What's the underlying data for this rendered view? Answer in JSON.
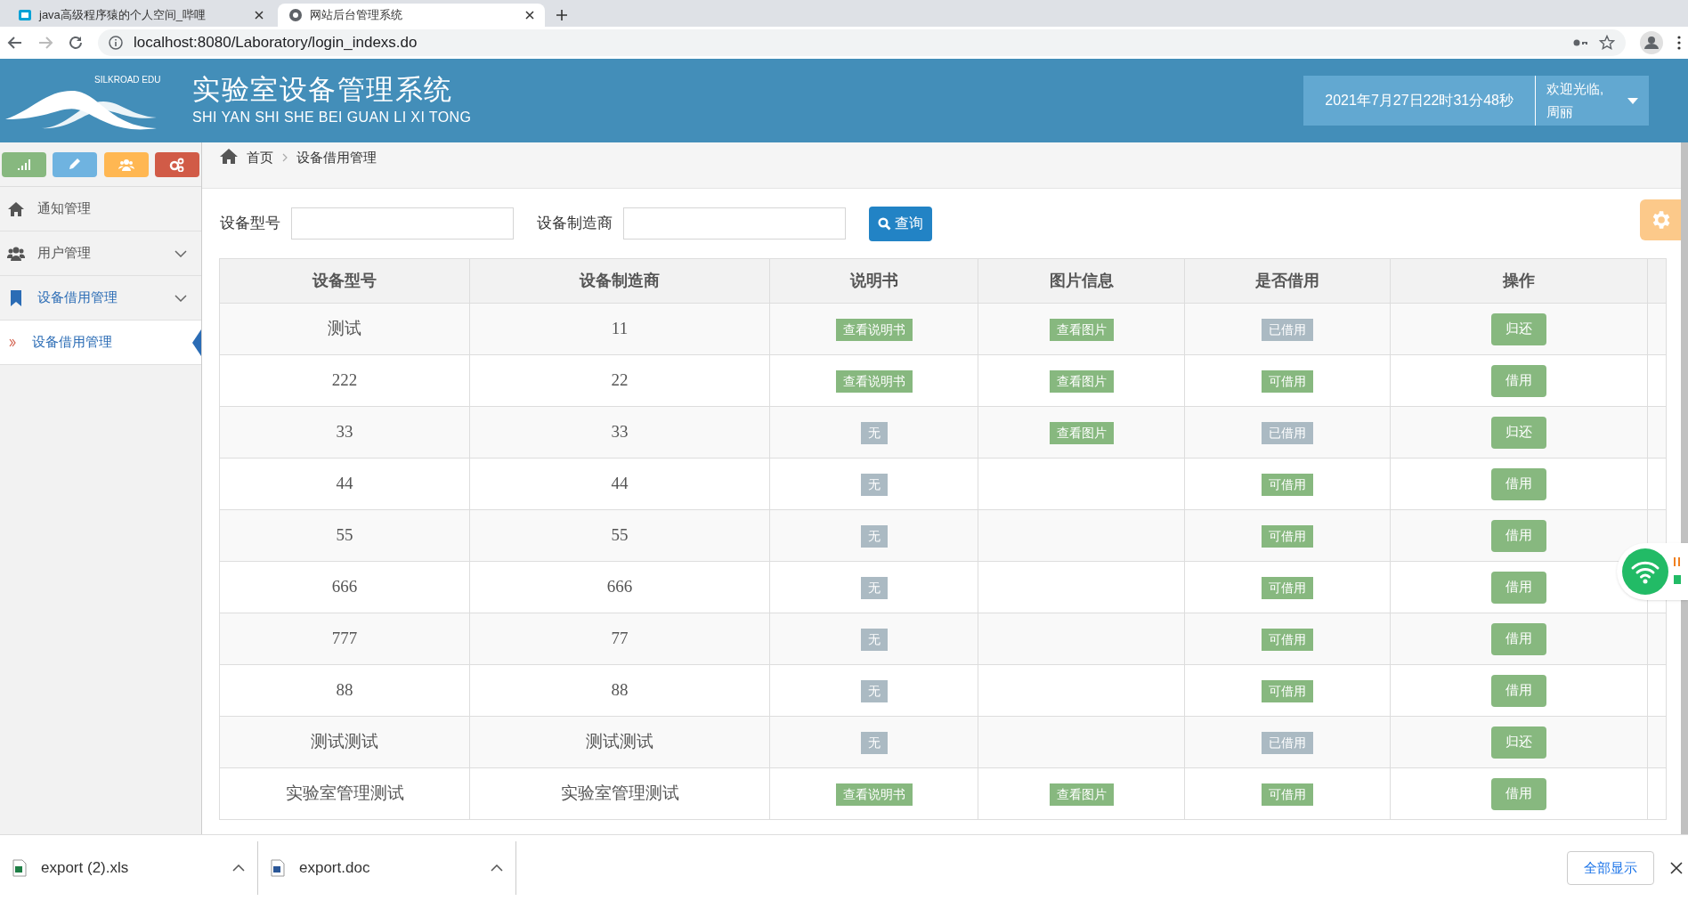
{
  "browser": {
    "tabs": [
      {
        "title": "java高级程序猿的个人空间_哔哩",
        "selected": false
      },
      {
        "title": "网站后台管理系统",
        "selected": true
      }
    ],
    "url": "localhost:8080/Laboratory/login_indexs.do"
  },
  "header": {
    "brand": "SILKROAD EDU",
    "title": "实验室设备管理系统",
    "subtitle": "SHI YAN SHI SHE BEI GUAN LI XI TONG",
    "datetime": "2021年7月27日22时31分48秒",
    "welcome": "欢迎光临,",
    "user": "周丽"
  },
  "sidebar": {
    "items": [
      {
        "label": "通知管理",
        "kind": "plain",
        "open": false
      },
      {
        "label": "用户管理",
        "kind": "group",
        "open": false
      },
      {
        "label": "设备借用管理",
        "kind": "group",
        "open": true,
        "children": [
          {
            "label": "设备借用管理",
            "selected": true
          }
        ]
      }
    ]
  },
  "breadcrumb": [
    "首页",
    "设备借用管理"
  ],
  "search": {
    "fields": [
      {
        "label": "设备型号"
      },
      {
        "label": "设备制造商"
      }
    ],
    "button": "查询"
  },
  "table": {
    "columns": [
      "设备型号",
      "设备制造商",
      "说明书",
      "图片信息",
      "是否借用",
      "操作"
    ],
    "rows": [
      {
        "model": "测试",
        "maker": "11",
        "manual": {
          "kind": "view",
          "label": "查看说明书"
        },
        "picture": "查看图片",
        "status": {
          "label": "已借用",
          "borrowed": true
        },
        "action": "归还"
      },
      {
        "model": "222",
        "maker": "22",
        "manual": {
          "kind": "view",
          "label": "查看说明书"
        },
        "picture": "查看图片",
        "status": {
          "label": "可借用",
          "borrowed": false
        },
        "action": "借用"
      },
      {
        "model": "33",
        "maker": "33",
        "manual": {
          "kind": "none",
          "label": "无"
        },
        "picture": "查看图片",
        "status": {
          "label": "已借用",
          "borrowed": true
        },
        "action": "归还"
      },
      {
        "model": "44",
        "maker": "44",
        "manual": {
          "kind": "none",
          "label": "无"
        },
        "status": {
          "label": "可借用",
          "borrowed": false
        },
        "action": "借用"
      },
      {
        "model": "55",
        "maker": "55",
        "manual": {
          "kind": "none",
          "label": "无"
        },
        "status": {
          "label": "可借用",
          "borrowed": false
        },
        "action": "借用"
      },
      {
        "model": "666",
        "maker": "666",
        "manual": {
          "kind": "none",
          "label": "无"
        },
        "status": {
          "label": "可借用",
          "borrowed": false
        },
        "action": "借用"
      },
      {
        "model": "777",
        "maker": "77",
        "manual": {
          "kind": "none",
          "label": "无"
        },
        "status": {
          "label": "可借用",
          "borrowed": false
        },
        "action": "借用"
      },
      {
        "model": "88",
        "maker": "88",
        "manual": {
          "kind": "none",
          "label": "无"
        },
        "status": {
          "label": "可借用",
          "borrowed": false
        },
        "action": "借用"
      },
      {
        "model": "测试测试",
        "maker": "测试测试",
        "manual": {
          "kind": "none",
          "label": "无"
        },
        "status": {
          "label": "已借用",
          "borrowed": true
        },
        "action": "归还"
      },
      {
        "model": "实验室管理测试",
        "maker": "实验室管理测试",
        "manual": {
          "kind": "view",
          "label": "查看说明书"
        },
        "picture": "查看图片",
        "status": {
          "label": "可借用",
          "borrowed": false
        },
        "action": "借用"
      }
    ]
  },
  "downloads": {
    "files": [
      {
        "name": "export (2).xls",
        "kind": "sheet"
      },
      {
        "name": "export.doc",
        "kind": "doc"
      }
    ],
    "show_all": "全部显示"
  }
}
